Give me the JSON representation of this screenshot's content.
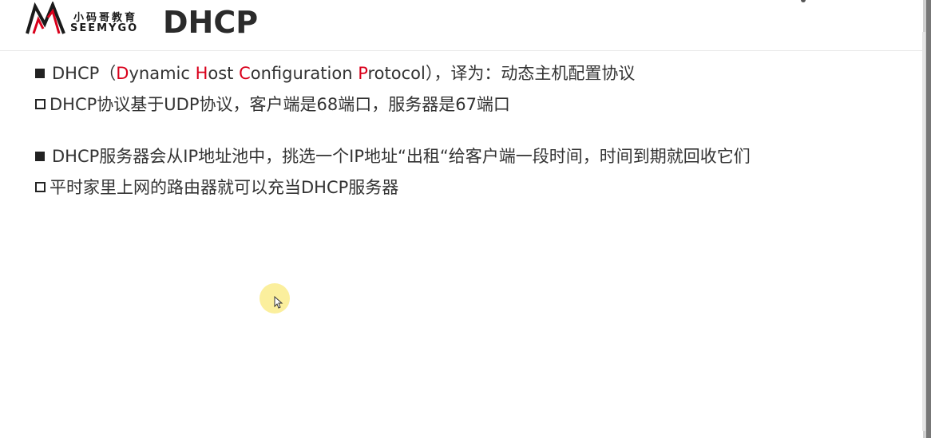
{
  "header": {
    "logo": {
      "cn": "小码哥教育",
      "en": "SEEMYGO"
    },
    "title": "DHCP"
  },
  "content": {
    "line1": {
      "prefix": "DHCP（",
      "d": "D",
      "ynamic": "ynamic ",
      "h": "H",
      "ost": "ost ",
      "c": "C",
      "onfiguration": "onfiguration ",
      "p": "P",
      "rotocol": "rotocol",
      "suffix": "），译为：动态主机配置协议"
    },
    "line2": "DHCP协议基于UDP协议，客户端是68端口，服务器是67端口",
    "line3": "DHCP服务器会从IP地址池中，挑选一个IP地址“出租“给客户端一段时间，时间到期就回收它们",
    "line4": "平时家里上网的路由器就可以充当DHCP服务器"
  },
  "colors": {
    "accent": "#d9001b",
    "text": "#333333",
    "title": "#2b2b2b",
    "cursor_highlight": "#faec8c"
  },
  "icons": {
    "logo": "m-logo-icon",
    "bullet_main": "filled-square-bullet-icon",
    "bullet_sub": "hollow-square-bullet-icon",
    "cursor": "mouse-pointer-icon"
  }
}
